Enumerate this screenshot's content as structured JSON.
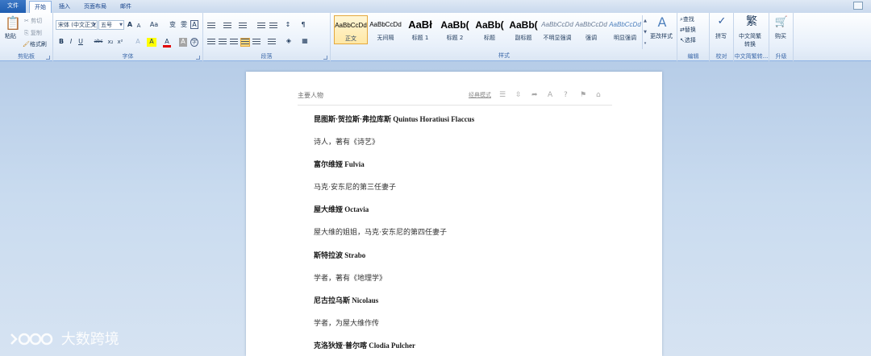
{
  "tabs": [
    {
      "label": "文件"
    },
    {
      "label": "开始"
    },
    {
      "label": "插入"
    },
    {
      "label": "页面布局"
    },
    {
      "label": "邮件"
    }
  ],
  "clipboard": {
    "paste": "粘贴",
    "cut": "剪切",
    "copy": "复制",
    "format_painter": "格式刷",
    "group": "剪贴板"
  },
  "font": {
    "font_name": "宋体 (中文正文)",
    "font_size": "五号",
    "group": "字体",
    "buttons": [
      "A",
      "A",
      "Aa",
      "变",
      "雯",
      "A",
      "B",
      "I",
      "U",
      "abc",
      "x₂",
      "x²",
      "A",
      "A",
      "A",
      "A",
      "字"
    ]
  },
  "paragraph": {
    "group": "段落"
  },
  "styles": {
    "group": "样式",
    "items": [
      {
        "sample": "AaBbCcDd",
        "name": "正文",
        "kind": "normal"
      },
      {
        "sample": "AaBbCcDd",
        "name": "无间隔",
        "kind": "normal"
      },
      {
        "sample": "AaBł",
        "name": "标题 1",
        "kind": "big"
      },
      {
        "sample": "AaBb(",
        "name": "标题 2",
        "kind": "mid"
      },
      {
        "sample": "AaBb(",
        "name": "标题",
        "kind": "mid"
      },
      {
        "sample": "AaBb(",
        "name": "副标题",
        "kind": "mid"
      },
      {
        "sample": "AaBbCcDd",
        "name": "不明显强调",
        "kind": "ital"
      },
      {
        "sample": "AaBbCcDd",
        "name": "强调",
        "kind": "ital"
      },
      {
        "sample": "AaBbCcDd",
        "name": "明显强调",
        "kind": "blue-ital"
      }
    ],
    "change_styles": "更改样式"
  },
  "editing": {
    "find": "查找",
    "replace": "替换",
    "select": "选择",
    "group": "编辑"
  },
  "proofing": {
    "spelling": "拼写",
    "group": "校对"
  },
  "chinese_conv": {
    "label1": "中文简繁",
    "label2": "转换",
    "group": "中文简繁转..."
  },
  "upgrade": {
    "buy": "购买",
    "group": "升级"
  },
  "document": {
    "header_title": "主要人物",
    "header_mode": "经典模式",
    "lines": [
      {
        "text": "昆图斯·贺拉斯·弗拉库斯 Quintus Horatiusi Flaccus",
        "bold": true
      },
      {
        "text": "诗人，著有《诗艺》",
        "bold": false
      },
      {
        "text": "富尔维娅 Fulvia",
        "bold": true
      },
      {
        "text": "马克·安东尼的第三任妻子",
        "bold": false
      },
      {
        "text": "屋大维娅 Octavia",
        "bold": true
      },
      {
        "text": "屋大维的姐姐，马克·安东尼的第四任妻子",
        "bold": false
      },
      {
        "text": "斯特拉波 Strabo",
        "bold": true
      },
      {
        "text": "学者，著有《地理学》",
        "bold": false
      },
      {
        "text": "尼古拉乌斯 Nicolaus",
        "bold": true
      },
      {
        "text": "学者，为屋大维作传",
        "bold": false
      },
      {
        "text": "克洛狄娅·普尔喀 Clodia Pulcher",
        "bold": true
      }
    ]
  },
  "watermark": {
    "text": "大数跨境"
  }
}
